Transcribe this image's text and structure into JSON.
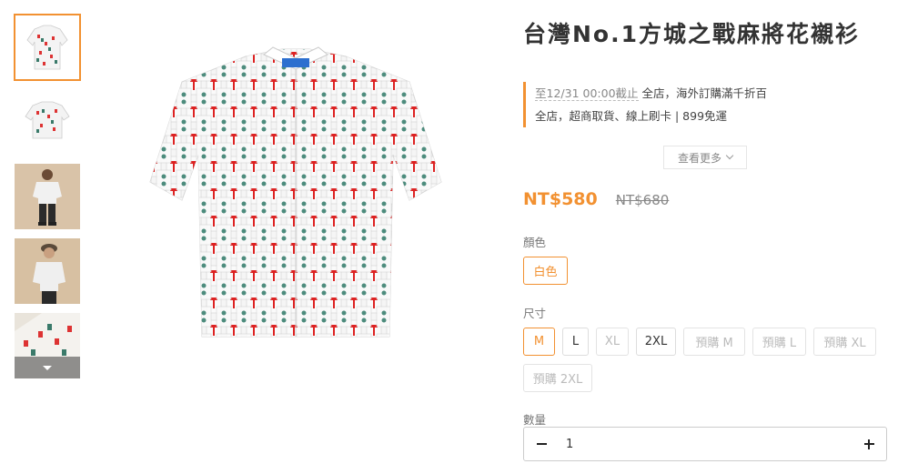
{
  "thumbnails": [
    {
      "name": "thumb-shirt-front"
    },
    {
      "name": "thumb-shirt-back"
    },
    {
      "name": "thumb-model-front"
    },
    {
      "name": "thumb-model-side"
    },
    {
      "name": "thumb-shirt-detail"
    }
  ],
  "icons": {
    "thumb_more": "chevron-down-icon",
    "more": "chevron-down-icon",
    "minus": "minus-icon",
    "plus": "plus-icon"
  },
  "product": {
    "title": "台灣No.1方城之戰麻將花襯衫",
    "promo": {
      "line1_date": "至12/31 00:00截止",
      "line1_text": " 全店，海外訂購滿千折百",
      "line2_text": "全店，超商取貨、線上刷卡 | 899免運"
    },
    "see_more": "查看更多",
    "price": "NT$580",
    "original_price": "NT$680",
    "color_label": "顏色",
    "colors": [
      "白色"
    ],
    "selected_color": "白色",
    "size_label": "尺寸",
    "sizes": [
      "M",
      "L",
      "XL",
      "2XL",
      "預購 M",
      "預購 L",
      "預購 XL",
      "預購 2XL"
    ],
    "selected_size": "M",
    "quantity_label": "數量",
    "quantity": "1"
  },
  "colors": {
    "accent": "#f29131",
    "border": "#dddddd",
    "disabled_text": "#bbbbbb"
  }
}
